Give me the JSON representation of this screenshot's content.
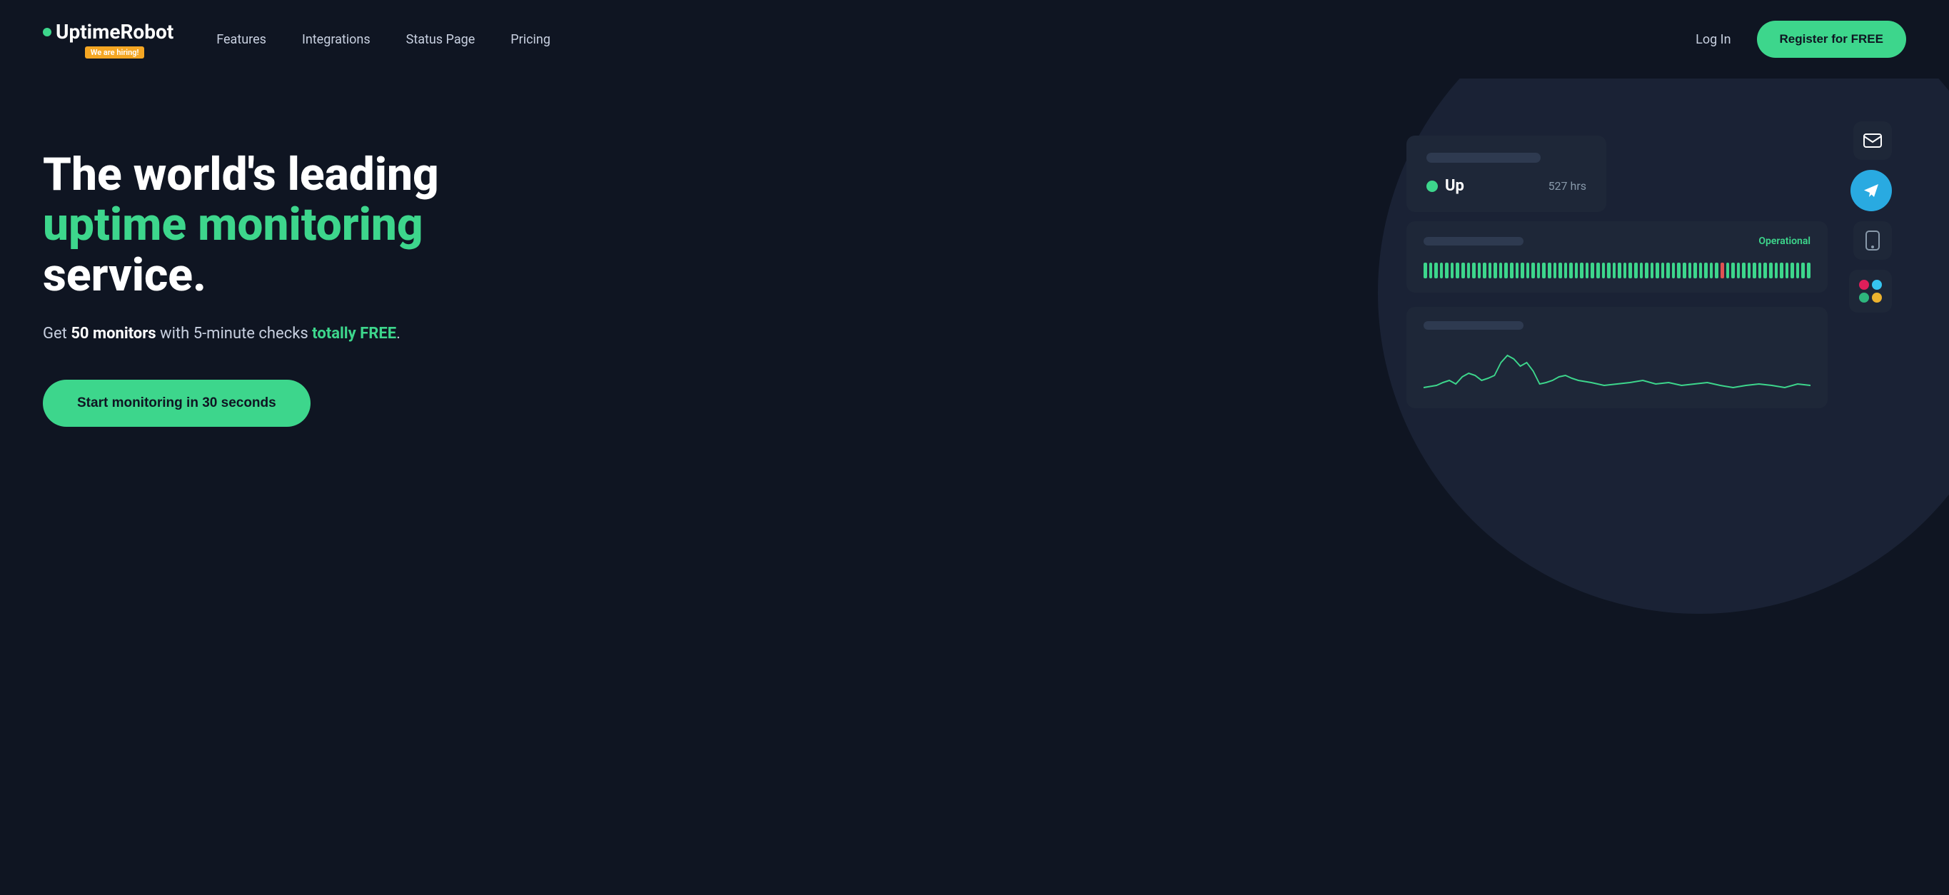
{
  "nav": {
    "logo_text": "UptimeRobot",
    "hiring_badge": "We are hiring!",
    "links": [
      {
        "label": "Features",
        "name": "features"
      },
      {
        "label": "Integrations",
        "name": "integrations"
      },
      {
        "label": "Status Page",
        "name": "status-page"
      },
      {
        "label": "Pricing",
        "name": "pricing"
      }
    ],
    "login_label": "Log In",
    "register_label": "Register for FREE"
  },
  "hero": {
    "heading_line1": "The world's leading",
    "heading_line2_green": "uptime monitoring",
    "heading_line2_white": " service.",
    "subtext_part1": "Get ",
    "subtext_bold": "50 monitors",
    "subtext_part2": " with 5-minute checks ",
    "subtext_green": "totally FREE",
    "subtext_end": ".",
    "cta_label": "Start monitoring in 30 seconds"
  },
  "dashboard": {
    "monitor_card": {
      "status": "Up",
      "hours": "527 hrs"
    },
    "status_bar_card": {
      "operational_label": "Operational"
    },
    "colors": {
      "green": "#3dd68c",
      "red": "#e05252",
      "dark_card": "#1e2738",
      "bar_bg": "#2e3a50"
    }
  }
}
